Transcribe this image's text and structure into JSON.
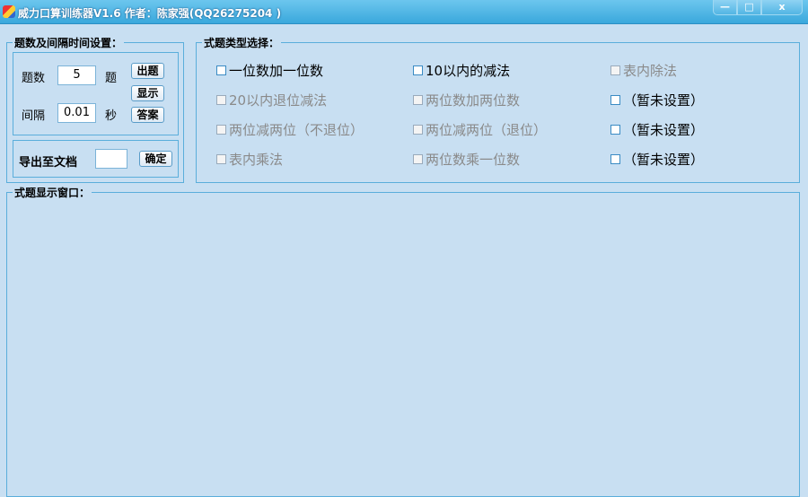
{
  "window": {
    "title": "威力口算训练器V1.6  作者：陈家强(QQ26275204 )",
    "minimize": "—",
    "maximize": "□",
    "close": "x"
  },
  "settings": {
    "group_label": "题数及间隔时间设置：",
    "count_label": "题数",
    "count_value": "5",
    "count_unit": "题",
    "interval_label": "间隔",
    "interval_value": "0.01",
    "interval_unit": "秒",
    "btn_generate": "出题",
    "btn_show": "显示",
    "btn_answer": "答案"
  },
  "export": {
    "label": "导出至文档",
    "value": "",
    "btn_ok": "确定"
  },
  "types": {
    "group_label": "式题类型选择：",
    "items": [
      {
        "label": "一位数加一位数",
        "enabled": true,
        "checked": false
      },
      {
        "label": "10以内的减法",
        "enabled": true,
        "checked": false
      },
      {
        "label": "表内除法",
        "enabled": false,
        "checked": false
      },
      {
        "label": "20以内退位减法",
        "enabled": false,
        "checked": false
      },
      {
        "label": "两位数加两位数",
        "enabled": false,
        "checked": false
      },
      {
        "label": "（暂未设置）",
        "enabled": true,
        "checked": false
      },
      {
        "label": "两位减两位（不退位）",
        "enabled": false,
        "checked": false
      },
      {
        "label": "两位减两位（退位）",
        "enabled": false,
        "checked": false
      },
      {
        "label": "（暂未设置）",
        "enabled": true,
        "checked": false
      },
      {
        "label": "表内乘法",
        "enabled": false,
        "checked": false
      },
      {
        "label": "两位数乘一位数",
        "enabled": false,
        "checked": false
      },
      {
        "label": "（暂未设置）",
        "enabled": true,
        "checked": false
      }
    ]
  },
  "display": {
    "group_label": "式题显示窗口："
  }
}
